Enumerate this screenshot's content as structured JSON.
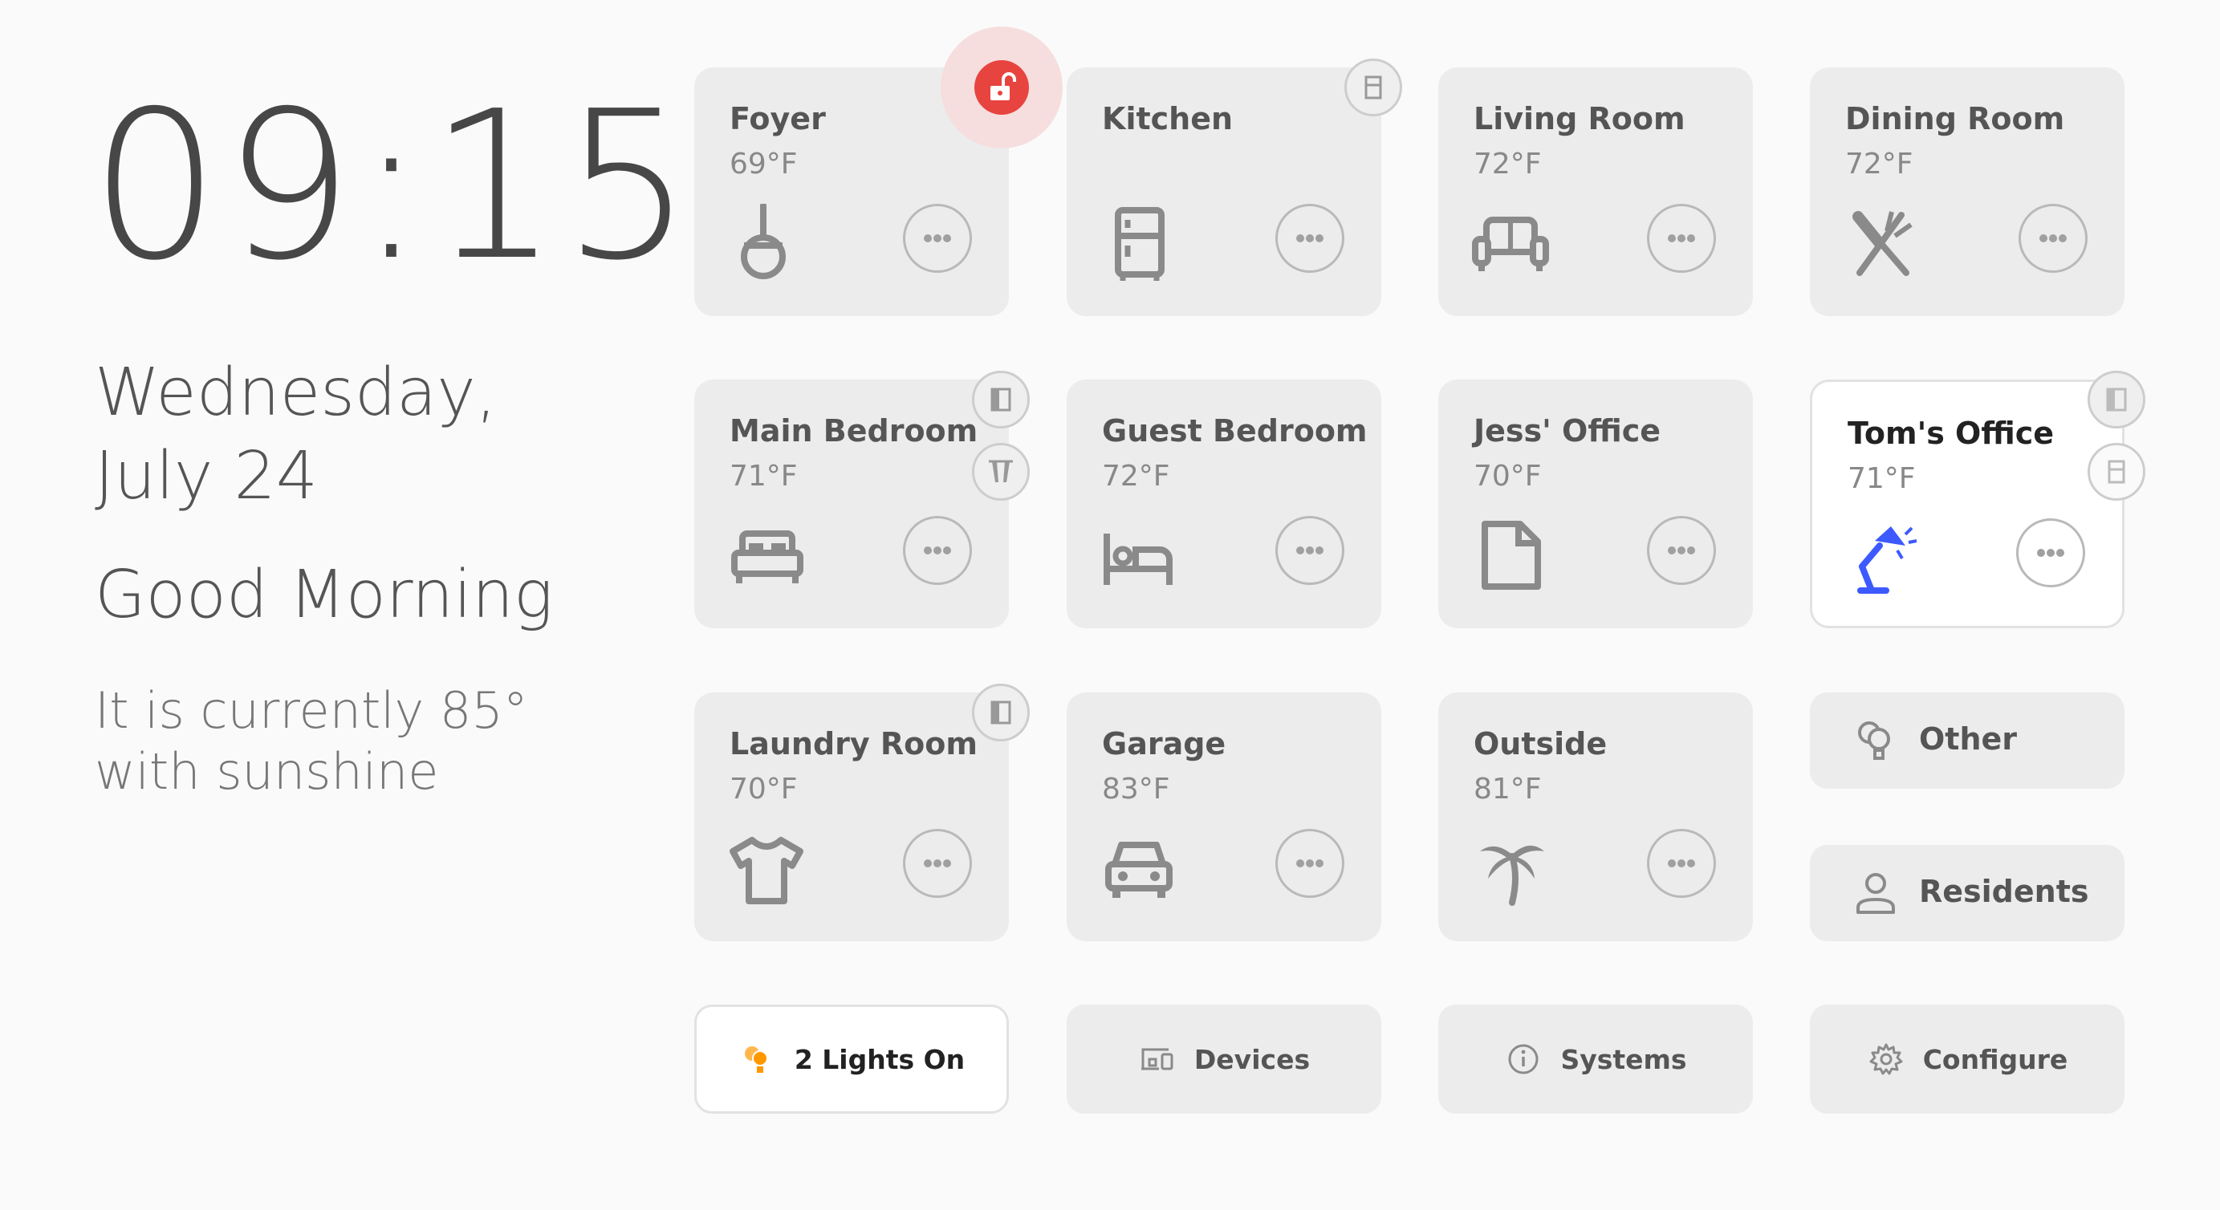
{
  "clock": {
    "time": "09:15"
  },
  "date": {
    "text": "Wednesday, July 24"
  },
  "greeting": "Good Morning",
  "weather": "It is currently 85° with sunshine",
  "rooms": [
    {
      "name": "Foyer",
      "temp": "69°F",
      "icon": "ceiling-light-icon"
    },
    {
      "name": "Kitchen",
      "temp": "",
      "icon": "fridge-icon"
    },
    {
      "name": "Living Room",
      "temp": "72°F",
      "icon": "sofa-icon"
    },
    {
      "name": "Dining Room",
      "temp": "72°F",
      "icon": "silverware-icon"
    },
    {
      "name": "Main Bedroom",
      "temp": "71°F",
      "icon": "double-bed-icon"
    },
    {
      "name": "Guest Bedroom",
      "temp": "72°F",
      "icon": "single-bed-icon"
    },
    {
      "name": "Jess' Office",
      "temp": "70°F",
      "icon": "document-icon"
    },
    {
      "name": "Tom's Office",
      "temp": "71°F",
      "icon": "desk-lamp-icon",
      "active": true
    },
    {
      "name": "Laundry Room",
      "temp": "70°F",
      "icon": "tshirt-icon"
    },
    {
      "name": "Garage",
      "temp": "83°F",
      "icon": "car-icon"
    },
    {
      "name": "Outside",
      "temp": "81°F",
      "icon": "palm-tree-icon"
    }
  ],
  "side_buttons": [
    {
      "label": "Other",
      "icon": "lightbulb-group-icon"
    },
    {
      "label": "Residents",
      "icon": "person-icon"
    }
  ],
  "bottom_buttons": [
    {
      "label": "2 Lights On",
      "icon": "lightbulb-group-on-icon",
      "active": true
    },
    {
      "label": "Devices",
      "icon": "devices-icon"
    },
    {
      "label": "Systems",
      "icon": "info-icon"
    },
    {
      "label": "Configure",
      "icon": "gear-icon"
    }
  ],
  "colors": {
    "accent_blue": "#3d5afe",
    "lock_red": "#e8443f",
    "lights_orange": "#ff9800",
    "tile_bg": "#ececec",
    "page_bg": "#fafafa"
  }
}
